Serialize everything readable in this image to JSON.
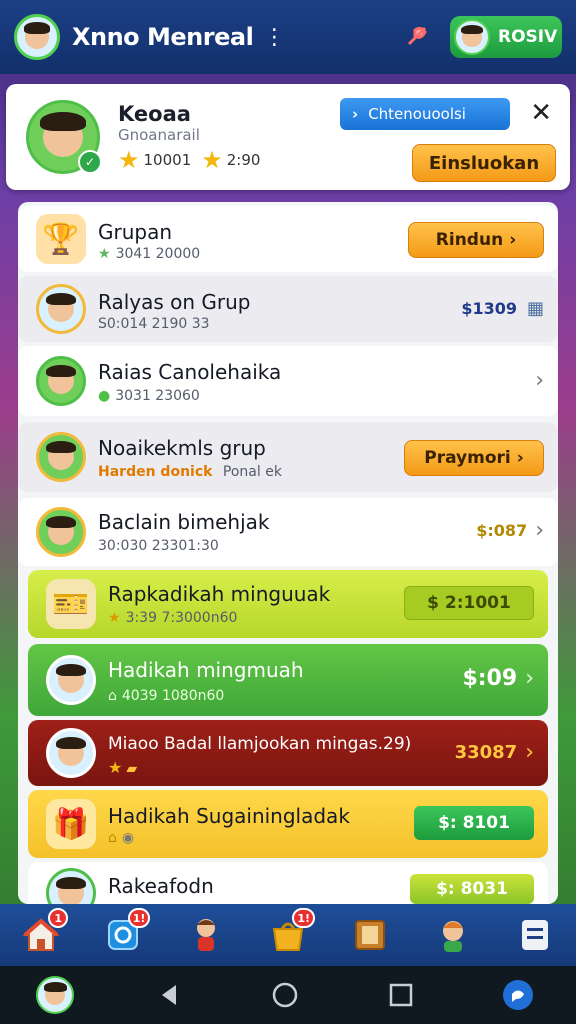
{
  "app": {
    "title": "Xnno Menreal",
    "menu_glyph": "⋮",
    "user_button_label": "ROSIV"
  },
  "profile": {
    "name": "Keoaa",
    "subtitle": "Gnoanarail",
    "stat_1": "10001",
    "stat_2": "2:90",
    "primary_button_label": "Chtenouoolsi",
    "secondary_button_label": "Einsluokan",
    "close_glyph": "✕"
  },
  "list": [
    {
      "title": "Grupan",
      "sub": "3041 20000",
      "action": "Rindun",
      "kind": "orange-action"
    },
    {
      "title": "Ralyas on Grup",
      "sub": "S0:014 2190 33",
      "price": "$1309",
      "kind": "price-icon"
    },
    {
      "title": "Raias Canolehaika",
      "sub": "3031 23060",
      "kind": "chevron"
    },
    {
      "title": "Noaikekmls grup",
      "sub": "Harden donick",
      "sub2": "Ponal ek",
      "action": "Praymori",
      "kind": "orange-action"
    },
    {
      "title": "Baclain bimehjak",
      "sub": "30:030 23301:30",
      "price": "$:087",
      "kind": "price-chevron"
    },
    {
      "title": "Rapkadikah minguuak",
      "sub": "3:39 7:3000n60",
      "action": "$ 2:1001",
      "kind": "lime"
    },
    {
      "title": "Hadikah mingmuah",
      "sub": "4039 1080n60",
      "price": "$:09",
      "kind": "green"
    },
    {
      "title": "Miaoo Badal llamjookan mingas.29)",
      "price": "33087",
      "kind": "red"
    },
    {
      "title": "Hadikah Sugainingladak",
      "action": "$: 8101",
      "kind": "yellow"
    },
    {
      "title": "Rakeafodn",
      "action": "$: 8031",
      "kind": "white-green"
    }
  ],
  "nav": {
    "badges": [
      "1",
      "1!",
      "1!"
    ]
  },
  "colors": {
    "accent_green": "#2fa84a",
    "accent_orange": "#f49a17",
    "accent_blue": "#1a72d6",
    "row_red": "#8b1a14",
    "row_lime": "#c9e43a"
  }
}
